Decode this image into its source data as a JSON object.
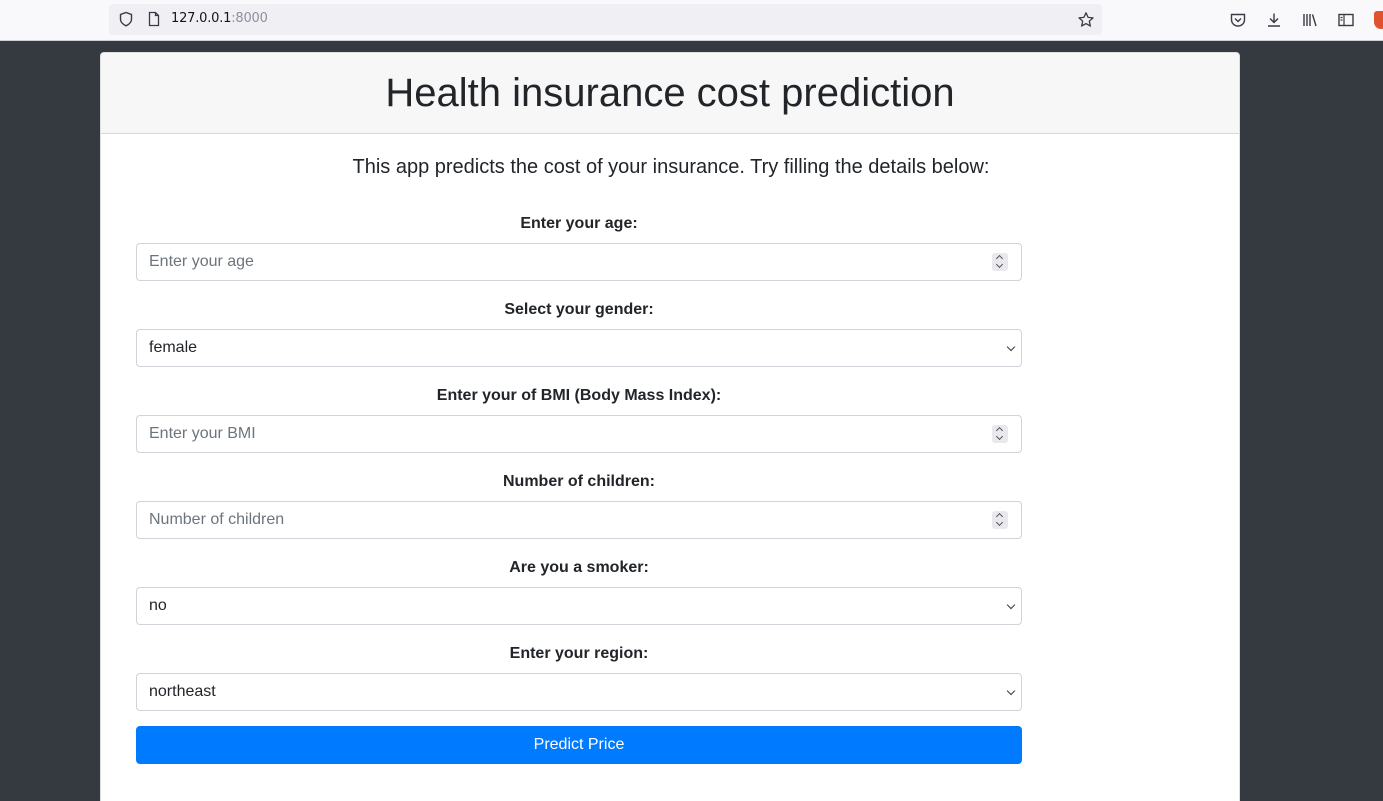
{
  "browser": {
    "url_host": "127.0.0.1",
    "url_port": ":8000"
  },
  "page": {
    "title": "Health insurance cost prediction",
    "subtitle": "This app predicts the cost of your insurance. Try filling the details below:"
  },
  "form": {
    "age": {
      "label": "Enter your age:",
      "placeholder": "Enter your age"
    },
    "gender": {
      "label": "Select your gender:",
      "value": "female"
    },
    "bmi": {
      "label": "Enter your of BMI (Body Mass Index):",
      "placeholder": "Enter your BMI"
    },
    "children": {
      "label": "Number of children:",
      "placeholder": "Number of children"
    },
    "smoker": {
      "label": "Are you a smoker:",
      "value": "no"
    },
    "region": {
      "label": "Enter your region:",
      "value": "northeast"
    },
    "submit_label": "Predict Price"
  },
  "colors": {
    "page_background": "#343a40",
    "primary": "#007bff"
  },
  "icons": [
    "shield-icon",
    "page-icon",
    "bookmark-star-icon",
    "pocket-icon",
    "download-icon",
    "library-icon",
    "sidebar-icon",
    "extension-icon"
  ]
}
